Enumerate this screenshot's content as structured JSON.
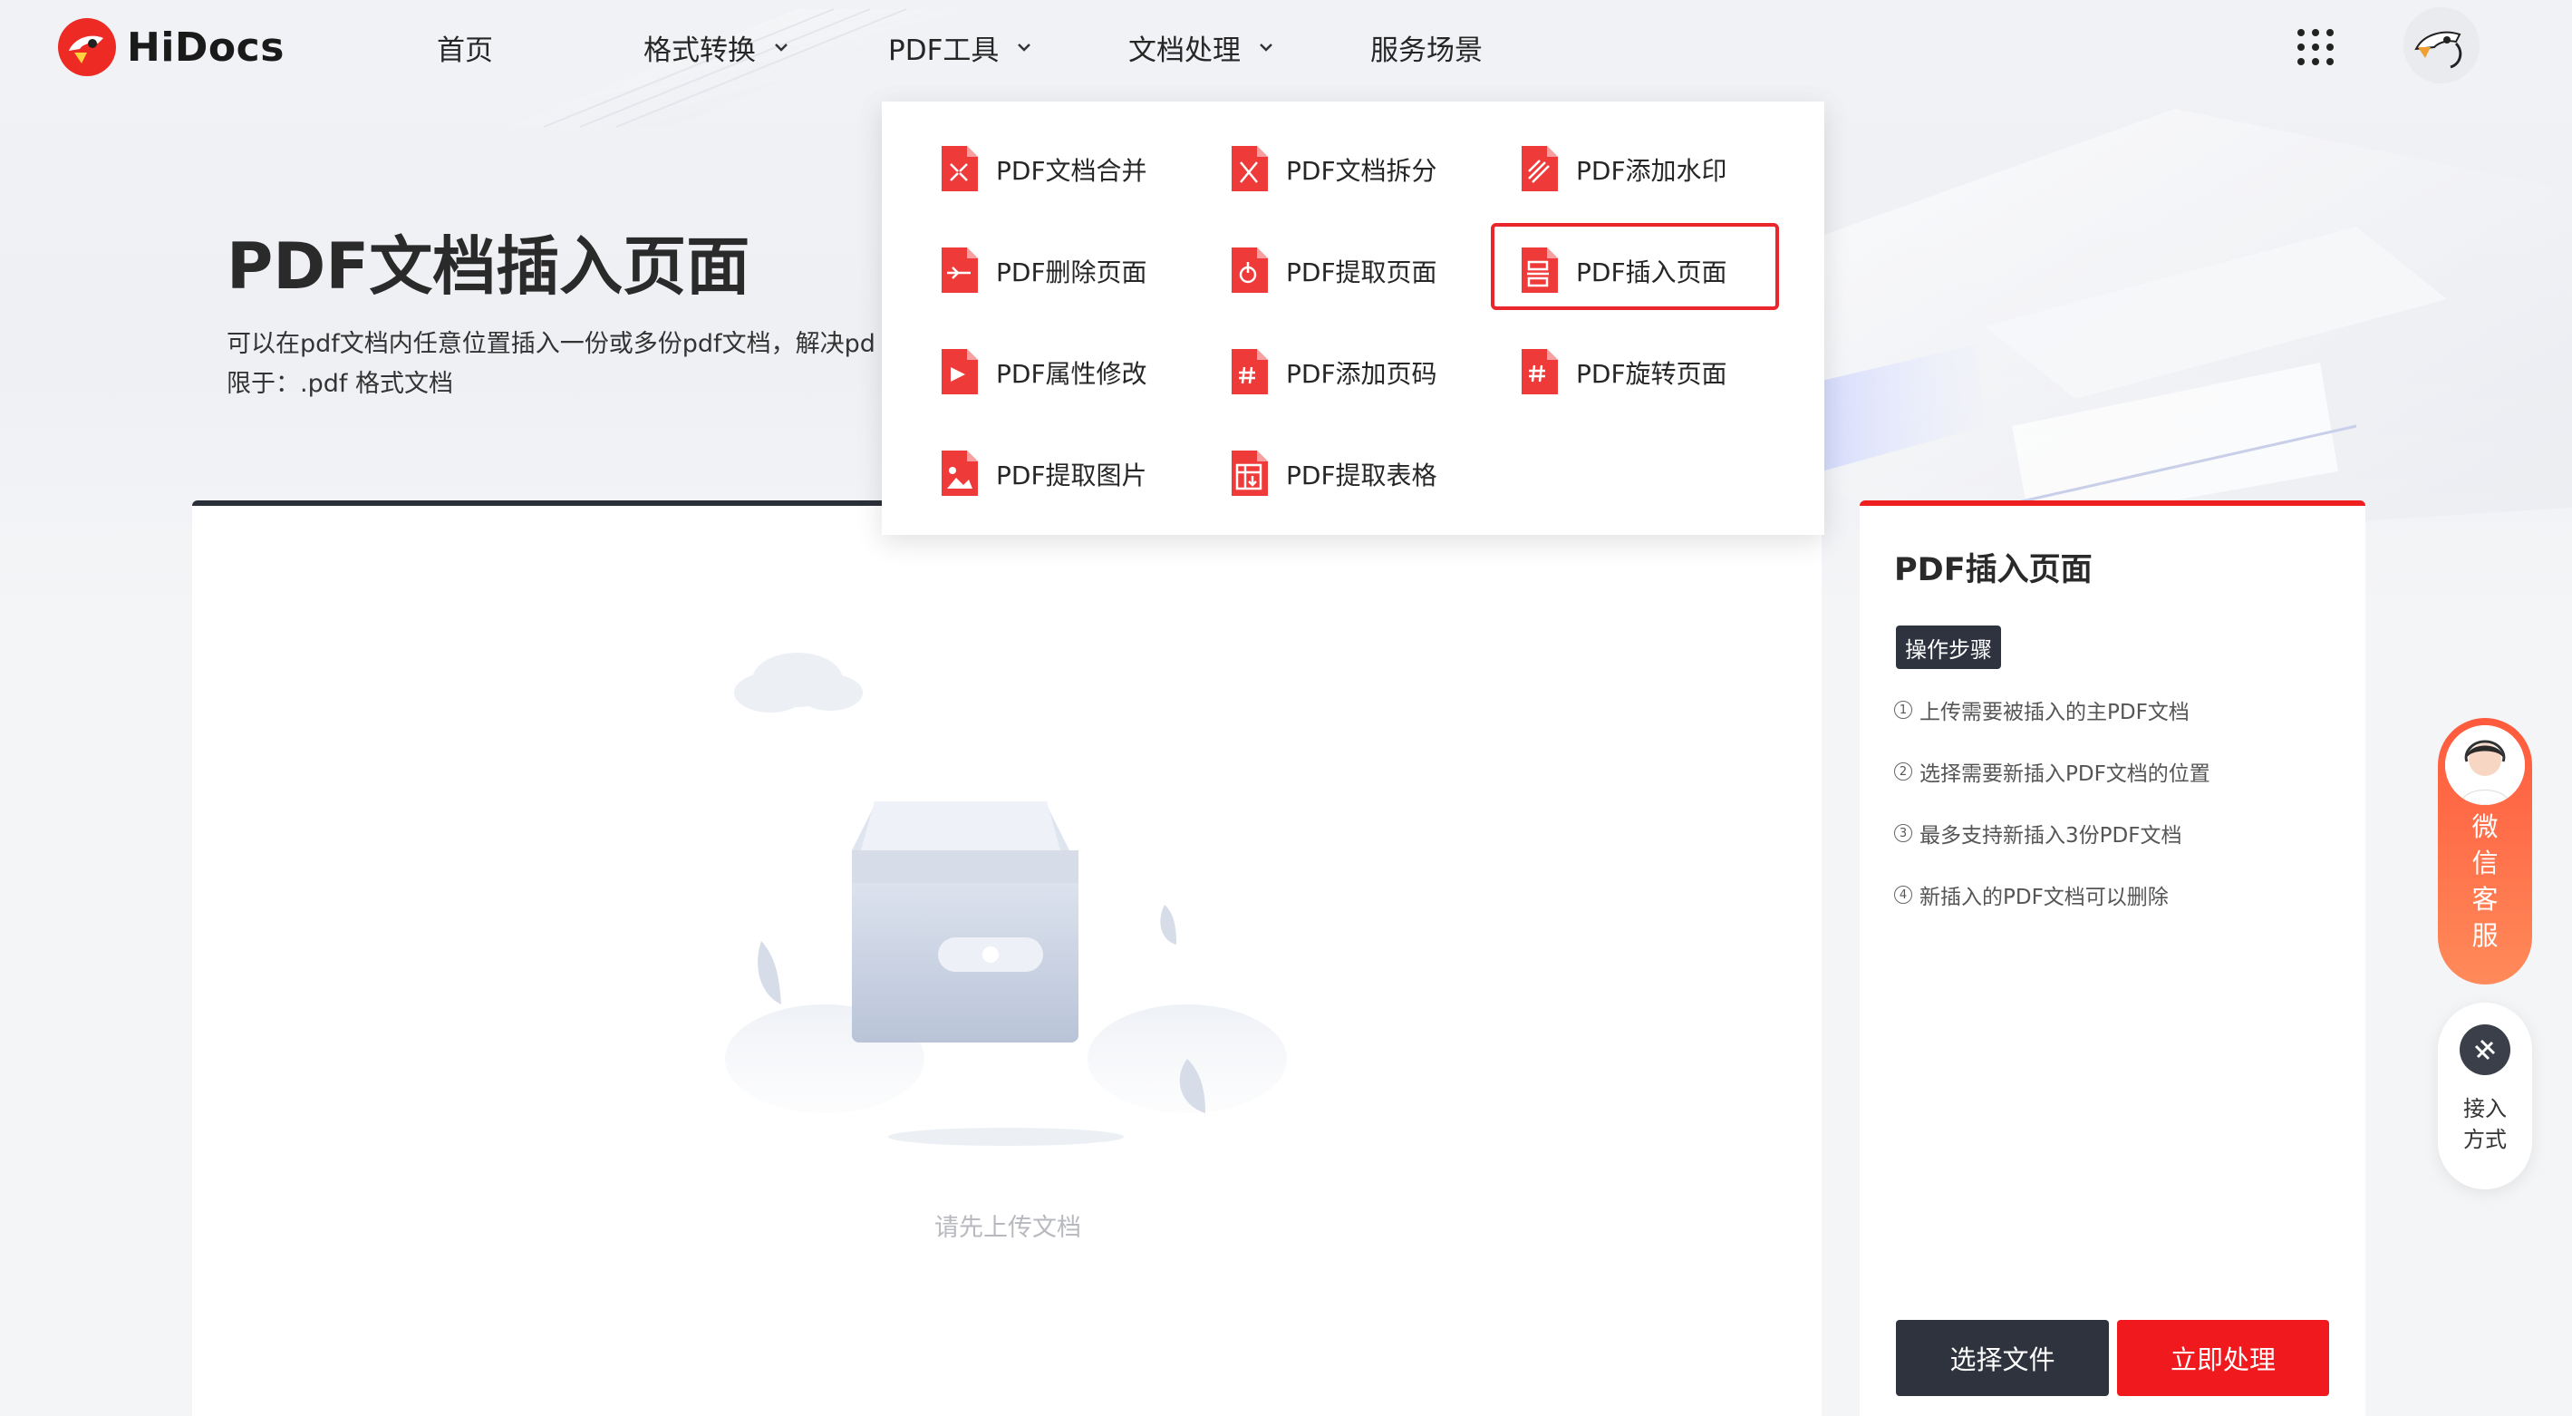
{
  "brand": {
    "name": "HiDocs"
  },
  "nav": {
    "items": [
      {
        "label": "首页"
      },
      {
        "label": "格式转换"
      },
      {
        "label": "PDF工具"
      },
      {
        "label": "文档处理"
      },
      {
        "label": "服务场景"
      }
    ]
  },
  "header_icons": {
    "apps": "grid-icon",
    "user": "avatar"
  },
  "hero": {
    "title": "PDF文档插入页面",
    "description": "可以在pdf文档内任意位置插入一份或多份pdf文档，解决pd",
    "limit": "限于：.pdf 格式文档"
  },
  "dropdown": {
    "items": [
      {
        "label": "PDF文档合并",
        "icon": "merge-icon"
      },
      {
        "label": "PDF文档拆分",
        "icon": "split-icon"
      },
      {
        "label": "PDF添加水印",
        "icon": "watermark-icon"
      },
      {
        "label": "PDF删除页面",
        "icon": "delete-page-icon"
      },
      {
        "label": "PDF提取页面",
        "icon": "extract-page-icon"
      },
      {
        "label": "PDF插入页面",
        "icon": "insert-page-icon",
        "selected": true
      },
      {
        "label": "PDF属性修改",
        "icon": "properties-icon"
      },
      {
        "label": "PDF添加页码",
        "icon": "page-number-icon"
      },
      {
        "label": "PDF旋转页面",
        "icon": "rotate-page-icon"
      },
      {
        "label": "PDF提取图片",
        "icon": "extract-image-icon"
      },
      {
        "label": "PDF提取表格",
        "icon": "extract-table-icon"
      }
    ]
  },
  "upload": {
    "empty_text": "请先上传文档"
  },
  "side": {
    "title": "PDF插入页面",
    "steps_label": "操作步骤",
    "steps": [
      {
        "num": "1",
        "text": "上传需要被插入的主PDF文档"
      },
      {
        "num": "2",
        "text": "选择需要新插入PDF文档的位置"
      },
      {
        "num": "3",
        "text": "最多支持新插入3份PDF文档"
      },
      {
        "num": "4",
        "text": "新插入的PDF文档可以删除"
      }
    ],
    "select_button": "选择文件",
    "process_button": "立即处理"
  },
  "float": {
    "wechat_label": "微信客服",
    "access_label": "接入方式"
  },
  "colors": {
    "accent": "#f0191e",
    "dark": "#2e333d"
  }
}
